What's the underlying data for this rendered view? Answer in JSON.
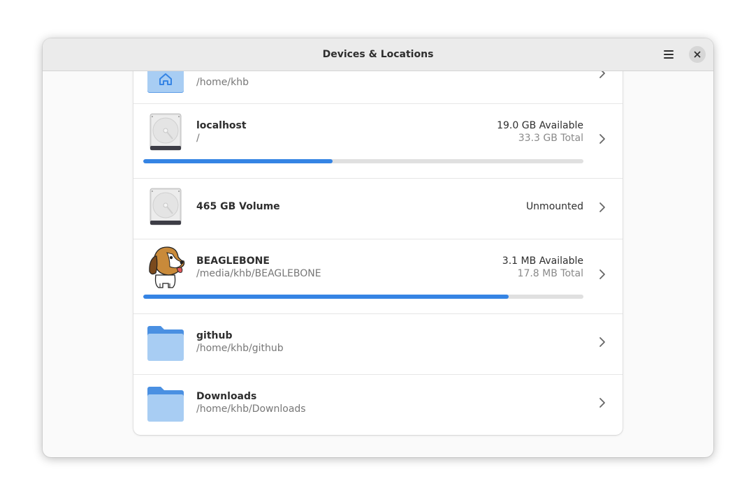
{
  "window": {
    "title": "Devices & Locations"
  },
  "locations": [
    {
      "icon": "home-folder-icon",
      "name": "",
      "path": "/home/khb",
      "available": "",
      "total": "",
      "used_fraction": null
    },
    {
      "icon": "hard-disk-icon",
      "name": "localhost",
      "path": "/",
      "available": "19.0 GB Available",
      "total": "33.3 GB Total",
      "used_fraction": 0.43
    },
    {
      "icon": "hard-disk-icon",
      "name": "465 GB Volume",
      "path": "",
      "status": "Unmounted"
    },
    {
      "icon": "beagle-dog-icon",
      "name": "BEAGLEBONE",
      "path": "/media/khb/BEAGLEBONE",
      "available": "3.1 MB Available",
      "total": "17.8 MB Total",
      "used_fraction": 0.83
    },
    {
      "icon": "folder-icon",
      "name": "github",
      "path": "/home/khb/github"
    },
    {
      "icon": "folder-icon",
      "name": "Downloads",
      "path": "/home/khb/Downloads"
    }
  ],
  "colors": {
    "accent": "#3584e4",
    "folder": "#62a0ea",
    "headerbar": "#ebebeb"
  }
}
